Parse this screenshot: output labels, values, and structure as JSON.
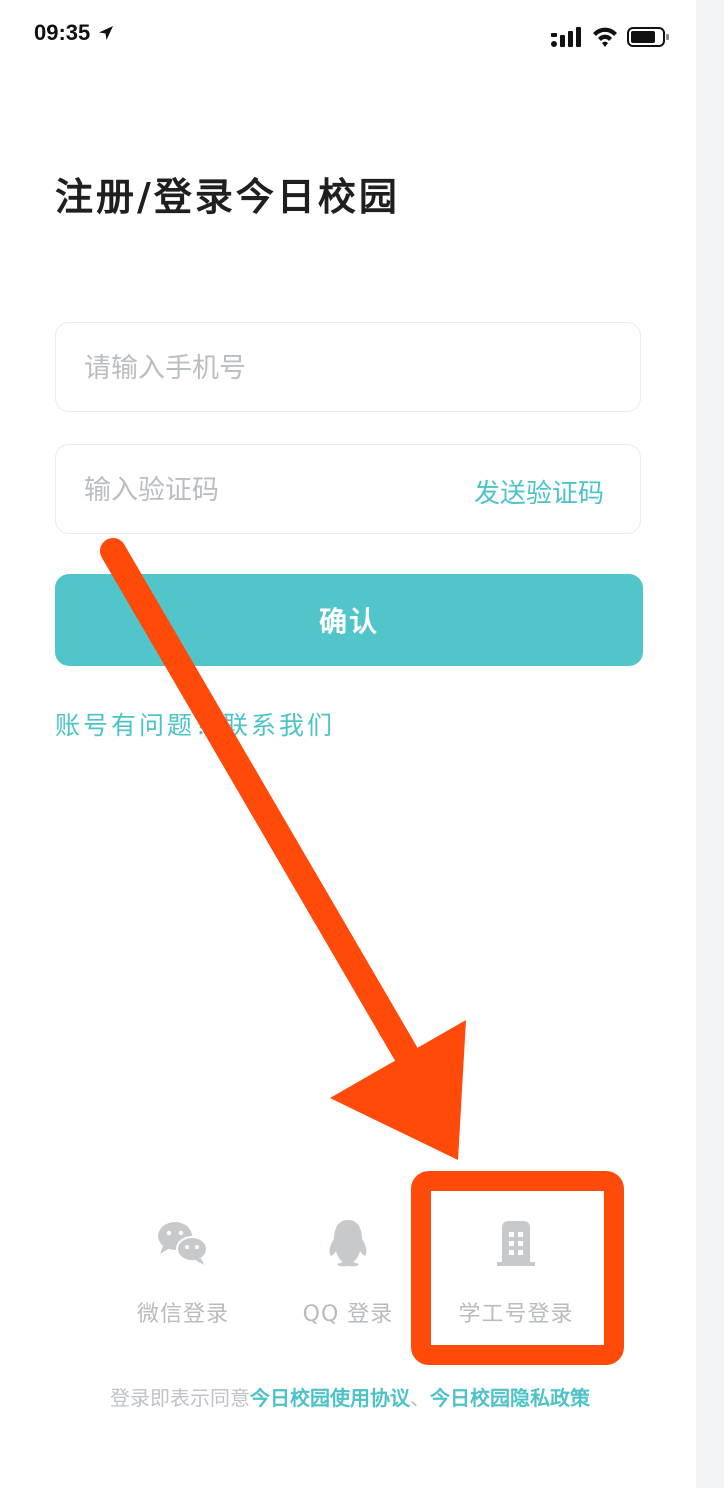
{
  "status_bar": {
    "time": "09:35",
    "icons": [
      "location-arrow-icon",
      "signal-icon",
      "wifi-icon",
      "battery-icon"
    ]
  },
  "title": "注册/登录今日校园",
  "phone": {
    "placeholder": "请输入手机号",
    "value": ""
  },
  "code": {
    "placeholder": "输入验证码",
    "value": "",
    "send_label": "发送验证码"
  },
  "confirm_label": "确认",
  "help_link": "账号有问题？联系我们",
  "login_options": [
    {
      "label": "微信登录",
      "icon": "wechat-icon"
    },
    {
      "label": "QQ 登录",
      "icon": "qq-penguin-icon"
    },
    {
      "label": "学工号登录",
      "icon": "building-icon"
    }
  ],
  "agreement": {
    "prefix": "登录即表示同意",
    "link1": "今日校园使用协议",
    "sep": "、",
    "link2": "今日校园隐私政策"
  },
  "colors": {
    "accent": "#52c5ca",
    "link": "#4dc3c8",
    "annotation": "#ff4a0a",
    "placeholder": "#b9bec4"
  }
}
